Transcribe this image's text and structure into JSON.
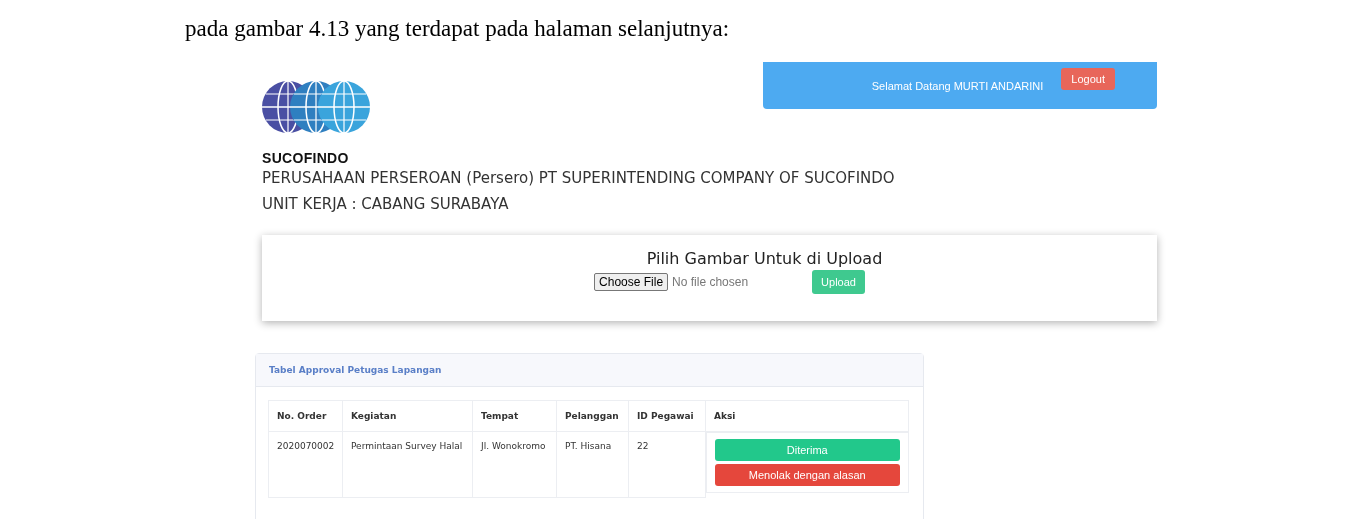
{
  "intro_text": "pada gambar 4.13 yang terdapat pada halaman selanjutnya:",
  "header": {
    "greeting": "Selamat Datang MURTI ANDARINI",
    "logout": "Logout"
  },
  "logo": {
    "name": "SUCOFINDO"
  },
  "company": {
    "name": "PERUSAHAAN PERSEROAN (Persero) PT SUPERINTENDING COMPANY OF SUCOFINDO",
    "unit": "UNIT KERJA : CABANG SURABAYA"
  },
  "upload": {
    "title": "Pilih Gambar Untuk di Upload",
    "choose_file": "Choose File",
    "file_status": "No file chosen",
    "button": "Upload"
  },
  "table": {
    "title": "Tabel Approval Petugas Lapangan",
    "columns": [
      "No. Order",
      "Kegiatan",
      "Tempat",
      "Pelanggan",
      "ID Pegawai",
      "Aksi"
    ],
    "rows": [
      {
        "cells": [
          "2020070002",
          "Permintaan Survey Halal",
          "Jl. Wonokromo",
          "PT. Hisana",
          "22"
        ],
        "actions": [
          {
            "label": "Diterima",
            "kind": "accept"
          },
          {
            "label": "Menolak dengan alasan",
            "kind": "reject"
          }
        ]
      }
    ]
  }
}
